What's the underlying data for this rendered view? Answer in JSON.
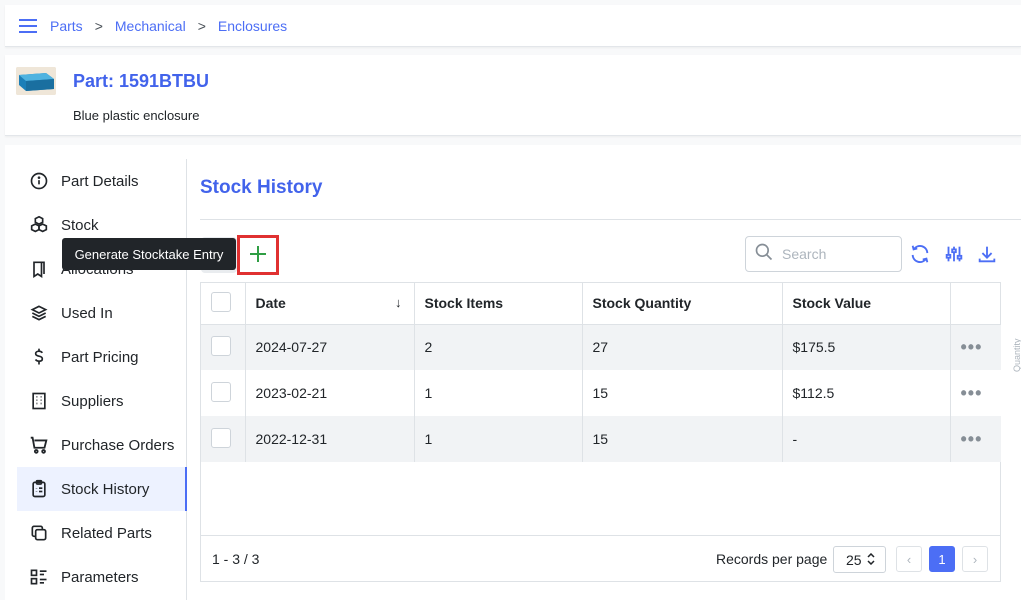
{
  "breadcrumb": [
    "Parts",
    "Mechanical",
    "Enclosures"
  ],
  "part": {
    "title": "Part: 1591BTBU",
    "description": "Blue plastic enclosure"
  },
  "sidebar": {
    "items": [
      {
        "label": "Part Details",
        "icon": "info-circle-icon"
      },
      {
        "label": "Stock",
        "icon": "boxes-icon"
      },
      {
        "label": "Allocations",
        "icon": "bookmarks-icon"
      },
      {
        "label": "Used In",
        "icon": "layers-icon"
      },
      {
        "label": "Part Pricing",
        "icon": "currency-dollar-icon"
      },
      {
        "label": "Suppliers",
        "icon": "building-icon"
      },
      {
        "label": "Purchase Orders",
        "icon": "shopping-cart-icon"
      },
      {
        "label": "Stock History",
        "icon": "clipboard-list-icon",
        "active": true
      },
      {
        "label": "Related Parts",
        "icon": "copy-icon"
      },
      {
        "label": "Parameters",
        "icon": "list-details-icon"
      }
    ]
  },
  "content": {
    "title": "Stock History"
  },
  "tooltip": "Generate Stocktake Entry",
  "search": {
    "placeholder": "Search"
  },
  "table": {
    "columns": [
      "Date",
      "Stock Items",
      "Stock Quantity",
      "Stock Value"
    ],
    "rows": [
      {
        "date": "2024-07-27",
        "items": "2",
        "quantity": "27",
        "value": "$175.5"
      },
      {
        "date": "2023-02-21",
        "items": "1",
        "quantity": "15",
        "value": "$112.5"
      },
      {
        "date": "2022-12-31",
        "items": "1",
        "quantity": "15",
        "value": "-"
      }
    ],
    "row_actions": "•••"
  },
  "footer": {
    "range": "1 - 3 / 3",
    "records_per_page_label": "Records per page",
    "records_per_page": "25",
    "prev": "‹",
    "page": "1",
    "next": "›"
  },
  "side_label": "Quantity",
  "colors": {
    "accent": "#4263eb",
    "highlight": "#e03131",
    "add": "#2f9e44"
  }
}
